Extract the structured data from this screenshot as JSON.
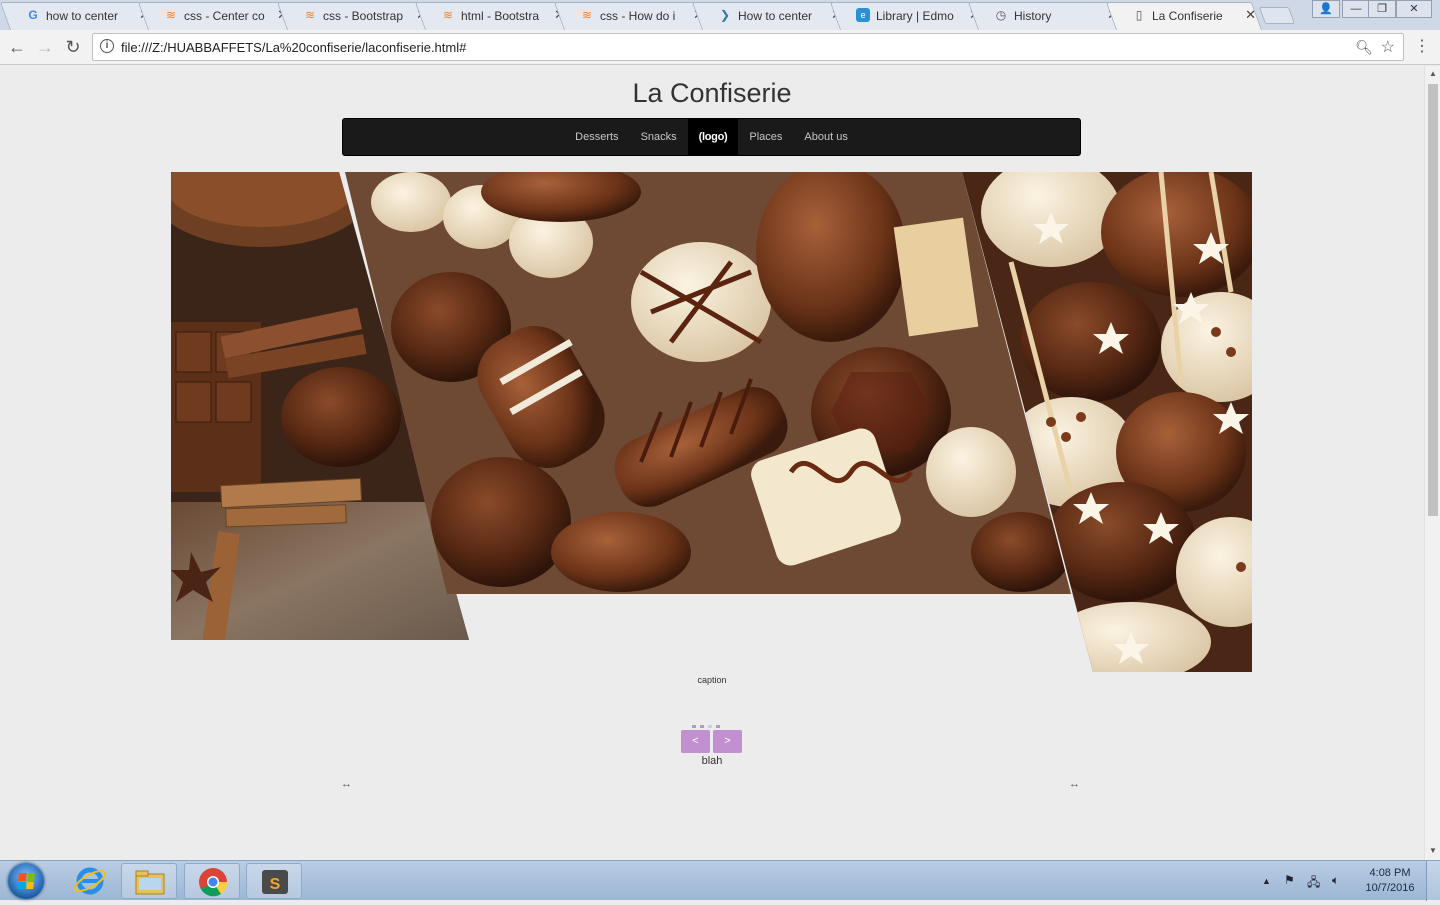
{
  "browser": {
    "tabs": [
      {
        "title": "how to center",
        "icon": "google-icon"
      },
      {
        "title": "css - Center co",
        "icon": "stackoverflow-icon"
      },
      {
        "title": "css - Bootstrap",
        "icon": "stackoverflow-icon"
      },
      {
        "title": "html - Bootstra",
        "icon": "stackoverflow-icon"
      },
      {
        "title": "css - How do i",
        "icon": "stackoverflow-icon"
      },
      {
        "title": "How to center",
        "icon": "codepen-icon"
      },
      {
        "title": "Library | Edmo",
        "icon": "edmodo-icon"
      },
      {
        "title": "History",
        "icon": "history-icon"
      },
      {
        "title": "La Confiserie",
        "icon": "page-icon",
        "active": true
      }
    ],
    "address": "file:///Z:/HUABBAFFETS/La%20confiserie/laconfiserie.html#"
  },
  "site": {
    "title": "La Confiserie",
    "nav": [
      "Desserts",
      "Snacks",
      "(logo)",
      "Places",
      "About us"
    ],
    "carousel": {
      "caption": "caption",
      "indicator_count": 4,
      "prev_label": "<",
      "next_label": ">",
      "under_text": "blah",
      "left_arrow": "↔",
      "right_arrow": "↔"
    }
  },
  "taskbar": {
    "time": "4:08 PM",
    "date": "10/7/2016",
    "apps": [
      "internet-explorer-icon",
      "file-explorer-icon",
      "chrome-icon",
      "sublime-text-icon"
    ]
  },
  "colors": {
    "navbar_bg": "#1a1a1a",
    "carousel_control": "#c28fd0",
    "page_bg": "#ececec"
  }
}
